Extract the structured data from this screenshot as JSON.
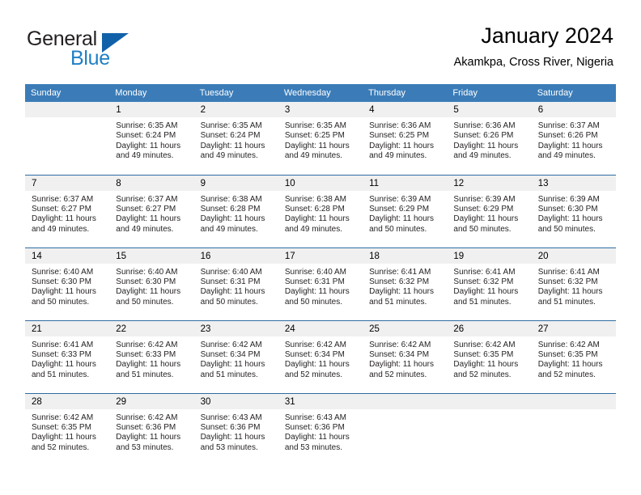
{
  "brand": {
    "name_part1": "General",
    "name_part2": "Blue",
    "triangle_icon": "triangle-icon",
    "accent_color": "#1161a8",
    "blue_text_color": "#1f7fc4"
  },
  "header": {
    "title": "January 2024",
    "subtitle": "Akamkpa, Cross River, Nigeria"
  },
  "theme": {
    "header_row_bg": "#3b7cb8",
    "daynum_bg": "#f0f0f0",
    "row_border": "#2e6da4",
    "text": "#231f20"
  },
  "weekdays": [
    "Sunday",
    "Monday",
    "Tuesday",
    "Wednesday",
    "Thursday",
    "Friday",
    "Saturday"
  ],
  "weeks": [
    [
      {
        "day": "",
        "sunrise": "",
        "sunset": "",
        "daylight_line1": "",
        "daylight_line2": "",
        "empty": true
      },
      {
        "day": "1",
        "sunrise": "Sunrise: 6:35 AM",
        "sunset": "Sunset: 6:24 PM",
        "daylight_line1": "Daylight: 11 hours",
        "daylight_line2": "and 49 minutes.",
        "empty": false
      },
      {
        "day": "2",
        "sunrise": "Sunrise: 6:35 AM",
        "sunset": "Sunset: 6:24 PM",
        "daylight_line1": "Daylight: 11 hours",
        "daylight_line2": "and 49 minutes.",
        "empty": false
      },
      {
        "day": "3",
        "sunrise": "Sunrise: 6:35 AM",
        "sunset": "Sunset: 6:25 PM",
        "daylight_line1": "Daylight: 11 hours",
        "daylight_line2": "and 49 minutes.",
        "empty": false
      },
      {
        "day": "4",
        "sunrise": "Sunrise: 6:36 AM",
        "sunset": "Sunset: 6:25 PM",
        "daylight_line1": "Daylight: 11 hours",
        "daylight_line2": "and 49 minutes.",
        "empty": false
      },
      {
        "day": "5",
        "sunrise": "Sunrise: 6:36 AM",
        "sunset": "Sunset: 6:26 PM",
        "daylight_line1": "Daylight: 11 hours",
        "daylight_line2": "and 49 minutes.",
        "empty": false
      },
      {
        "day": "6",
        "sunrise": "Sunrise: 6:37 AM",
        "sunset": "Sunset: 6:26 PM",
        "daylight_line1": "Daylight: 11 hours",
        "daylight_line2": "and 49 minutes.",
        "empty": false
      }
    ],
    [
      {
        "day": "7",
        "sunrise": "Sunrise: 6:37 AM",
        "sunset": "Sunset: 6:27 PM",
        "daylight_line1": "Daylight: 11 hours",
        "daylight_line2": "and 49 minutes.",
        "empty": false
      },
      {
        "day": "8",
        "sunrise": "Sunrise: 6:37 AM",
        "sunset": "Sunset: 6:27 PM",
        "daylight_line1": "Daylight: 11 hours",
        "daylight_line2": "and 49 minutes.",
        "empty": false
      },
      {
        "day": "9",
        "sunrise": "Sunrise: 6:38 AM",
        "sunset": "Sunset: 6:28 PM",
        "daylight_line1": "Daylight: 11 hours",
        "daylight_line2": "and 49 minutes.",
        "empty": false
      },
      {
        "day": "10",
        "sunrise": "Sunrise: 6:38 AM",
        "sunset": "Sunset: 6:28 PM",
        "daylight_line1": "Daylight: 11 hours",
        "daylight_line2": "and 49 minutes.",
        "empty": false
      },
      {
        "day": "11",
        "sunrise": "Sunrise: 6:39 AM",
        "sunset": "Sunset: 6:29 PM",
        "daylight_line1": "Daylight: 11 hours",
        "daylight_line2": "and 50 minutes.",
        "empty": false
      },
      {
        "day": "12",
        "sunrise": "Sunrise: 6:39 AM",
        "sunset": "Sunset: 6:29 PM",
        "daylight_line1": "Daylight: 11 hours",
        "daylight_line2": "and 50 minutes.",
        "empty": false
      },
      {
        "day": "13",
        "sunrise": "Sunrise: 6:39 AM",
        "sunset": "Sunset: 6:30 PM",
        "daylight_line1": "Daylight: 11 hours",
        "daylight_line2": "and 50 minutes.",
        "empty": false
      }
    ],
    [
      {
        "day": "14",
        "sunrise": "Sunrise: 6:40 AM",
        "sunset": "Sunset: 6:30 PM",
        "daylight_line1": "Daylight: 11 hours",
        "daylight_line2": "and 50 minutes.",
        "empty": false
      },
      {
        "day": "15",
        "sunrise": "Sunrise: 6:40 AM",
        "sunset": "Sunset: 6:30 PM",
        "daylight_line1": "Daylight: 11 hours",
        "daylight_line2": "and 50 minutes.",
        "empty": false
      },
      {
        "day": "16",
        "sunrise": "Sunrise: 6:40 AM",
        "sunset": "Sunset: 6:31 PM",
        "daylight_line1": "Daylight: 11 hours",
        "daylight_line2": "and 50 minutes.",
        "empty": false
      },
      {
        "day": "17",
        "sunrise": "Sunrise: 6:40 AM",
        "sunset": "Sunset: 6:31 PM",
        "daylight_line1": "Daylight: 11 hours",
        "daylight_line2": "and 50 minutes.",
        "empty": false
      },
      {
        "day": "18",
        "sunrise": "Sunrise: 6:41 AM",
        "sunset": "Sunset: 6:32 PM",
        "daylight_line1": "Daylight: 11 hours",
        "daylight_line2": "and 51 minutes.",
        "empty": false
      },
      {
        "day": "19",
        "sunrise": "Sunrise: 6:41 AM",
        "sunset": "Sunset: 6:32 PM",
        "daylight_line1": "Daylight: 11 hours",
        "daylight_line2": "and 51 minutes.",
        "empty": false
      },
      {
        "day": "20",
        "sunrise": "Sunrise: 6:41 AM",
        "sunset": "Sunset: 6:32 PM",
        "daylight_line1": "Daylight: 11 hours",
        "daylight_line2": "and 51 minutes.",
        "empty": false
      }
    ],
    [
      {
        "day": "21",
        "sunrise": "Sunrise: 6:41 AM",
        "sunset": "Sunset: 6:33 PM",
        "daylight_line1": "Daylight: 11 hours",
        "daylight_line2": "and 51 minutes.",
        "empty": false
      },
      {
        "day": "22",
        "sunrise": "Sunrise: 6:42 AM",
        "sunset": "Sunset: 6:33 PM",
        "daylight_line1": "Daylight: 11 hours",
        "daylight_line2": "and 51 minutes.",
        "empty": false
      },
      {
        "day": "23",
        "sunrise": "Sunrise: 6:42 AM",
        "sunset": "Sunset: 6:34 PM",
        "daylight_line1": "Daylight: 11 hours",
        "daylight_line2": "and 51 minutes.",
        "empty": false
      },
      {
        "day": "24",
        "sunrise": "Sunrise: 6:42 AM",
        "sunset": "Sunset: 6:34 PM",
        "daylight_line1": "Daylight: 11 hours",
        "daylight_line2": "and 52 minutes.",
        "empty": false
      },
      {
        "day": "25",
        "sunrise": "Sunrise: 6:42 AM",
        "sunset": "Sunset: 6:34 PM",
        "daylight_line1": "Daylight: 11 hours",
        "daylight_line2": "and 52 minutes.",
        "empty": false
      },
      {
        "day": "26",
        "sunrise": "Sunrise: 6:42 AM",
        "sunset": "Sunset: 6:35 PM",
        "daylight_line1": "Daylight: 11 hours",
        "daylight_line2": "and 52 minutes.",
        "empty": false
      },
      {
        "day": "27",
        "sunrise": "Sunrise: 6:42 AM",
        "sunset": "Sunset: 6:35 PM",
        "daylight_line1": "Daylight: 11 hours",
        "daylight_line2": "and 52 minutes.",
        "empty": false
      }
    ],
    [
      {
        "day": "28",
        "sunrise": "Sunrise: 6:42 AM",
        "sunset": "Sunset: 6:35 PM",
        "daylight_line1": "Daylight: 11 hours",
        "daylight_line2": "and 52 minutes.",
        "empty": false
      },
      {
        "day": "29",
        "sunrise": "Sunrise: 6:42 AM",
        "sunset": "Sunset: 6:36 PM",
        "daylight_line1": "Daylight: 11 hours",
        "daylight_line2": "and 53 minutes.",
        "empty": false
      },
      {
        "day": "30",
        "sunrise": "Sunrise: 6:43 AM",
        "sunset": "Sunset: 6:36 PM",
        "daylight_line1": "Daylight: 11 hours",
        "daylight_line2": "and 53 minutes.",
        "empty": false
      },
      {
        "day": "31",
        "sunrise": "Sunrise: 6:43 AM",
        "sunset": "Sunset: 6:36 PM",
        "daylight_line1": "Daylight: 11 hours",
        "daylight_line2": "and 53 minutes.",
        "empty": false
      },
      {
        "day": "",
        "sunrise": "",
        "sunset": "",
        "daylight_line1": "",
        "daylight_line2": "",
        "empty": true
      },
      {
        "day": "",
        "sunrise": "",
        "sunset": "",
        "daylight_line1": "",
        "daylight_line2": "",
        "empty": true
      },
      {
        "day": "",
        "sunrise": "",
        "sunset": "",
        "daylight_line1": "",
        "daylight_line2": "",
        "empty": true
      }
    ]
  ]
}
